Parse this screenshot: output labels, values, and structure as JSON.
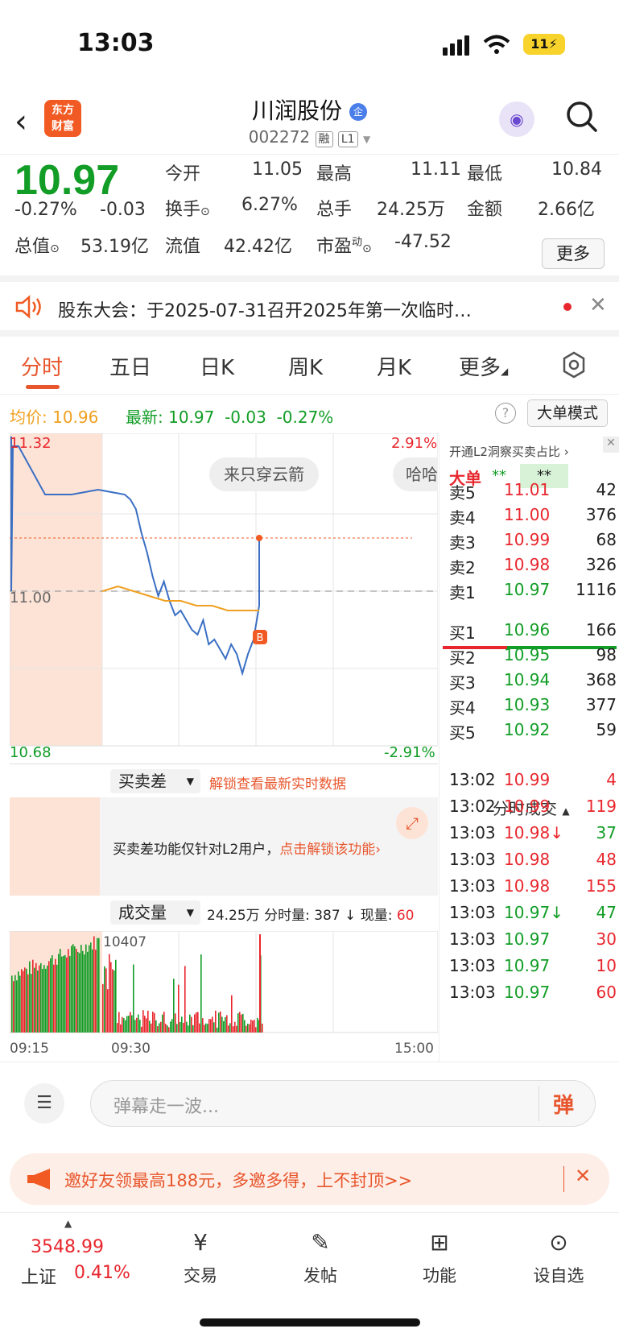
{
  "status": {
    "time": "13:03",
    "battery": "11"
  },
  "header": {
    "logo_line1": "东方",
    "logo_line2": "财富",
    "name": "川润股份",
    "badge": "企",
    "code": "002272",
    "tag1": "融",
    "tag2": "L1"
  },
  "quote": {
    "price": "10.97",
    "change_pct": "-0.27%",
    "change": "-0.03",
    "open_label": "今开",
    "open": "11.05",
    "high_label": "最高",
    "high": "11.11",
    "low_label": "最低",
    "low": "10.84",
    "turnover_label": "换手",
    "turnover": "6.27%",
    "volume_label": "总手",
    "volume": "24.25万",
    "amount_label": "金额",
    "amount": "2.66亿",
    "mktcap_label": "总值",
    "mktcap": "53.19亿",
    "float_label": "流值",
    "float": "42.42亿",
    "pe_label": "市盈",
    "pe_sup": "动",
    "pe": "-47.52",
    "more": "更多"
  },
  "notice": {
    "text": "股东大会：于2025-07-31召开2025年第一次临时…"
  },
  "tabs": [
    "分时",
    "五日",
    "日K",
    "周K",
    "月K",
    "更多"
  ],
  "avg": {
    "avg_label": "均价:",
    "avg": "10.96",
    "latest_label": "最新:",
    "latest": "10.97",
    "chg": "-0.03",
    "pct": "-0.27%",
    "mode": "大单模式"
  },
  "chart_data": {
    "type": "line",
    "title": "",
    "y_range": [
      10.68,
      11.32
    ],
    "y_ticks": {
      "top": "11.32",
      "mid": "11.00",
      "bottom": "10.68",
      "pct_top": "2.91%",
      "pct_bottom": "-2.91%"
    },
    "prev_close": 11.0,
    "x_ticks": [
      "09:15",
      "09:30",
      "15:00"
    ],
    "series": [
      {
        "values": [
          11.3,
          11.2,
          11.2,
          11.21,
          11.2,
          11.19,
          11.17,
          11.12,
          11.08,
          11.03,
          10.99,
          11.02,
          10.98,
          10.95,
          10.96,
          10.94,
          10.92,
          10.91,
          10.94,
          10.89,
          10.9,
          10.88,
          10.86,
          10.89,
          10.87,
          10.83,
          10.87,
          10.9,
          10.97
        ]
      },
      {
        "values": [
          11.0,
          11.01,
          11.0,
          10.99,
          10.98,
          10.98,
          10.97,
          10.97,
          10.96,
          10.96,
          10.96
        ]
      }
    ],
    "markers": {
      "buy": "B",
      "bubble1": "来只穿云箭",
      "bubble2": "哈哈"
    },
    "indicator_label": "买卖差",
    "indicator_unlock": "解锁查看最新实时数据",
    "indicator_msg": "买卖差功能仅针对L2用户，",
    "indicator_link": "点击解锁该功能",
    "volume_label": "成交量",
    "volume_info": "24.25万 分时量: 387 ↓ 现量:",
    "volume_now": "60",
    "volume_max": "10407"
  },
  "orderbook": {
    "promo": "开通L2洞察买卖占比",
    "big_label": "大单",
    "big_stars": "**",
    "big_stars2": "**",
    "asks": [
      [
        "卖5",
        "11.01",
        "42"
      ],
      [
        "卖4",
        "11.00",
        "376"
      ],
      [
        "卖3",
        "10.99",
        "68"
      ],
      [
        "卖2",
        "10.98",
        "326"
      ],
      [
        "卖1",
        "10.97",
        "1116"
      ]
    ],
    "bids": [
      [
        "买1",
        "10.96",
        "166"
      ],
      [
        "买2",
        "10.95",
        "98"
      ],
      [
        "买3",
        "10.94",
        "368"
      ],
      [
        "买4",
        "10.93",
        "377"
      ],
      [
        "买5",
        "10.92",
        "59"
      ]
    ],
    "trades_title": "分时成交",
    "trades": [
      [
        "13:02",
        "10.99",
        "4"
      ],
      [
        "13:02",
        "10.99",
        "119"
      ],
      [
        "13:03",
        "10.98↓",
        "37"
      ],
      [
        "13:03",
        "10.98",
        "48"
      ],
      [
        "13:03",
        "10.98",
        "155"
      ],
      [
        "13:03",
        "10.97↓",
        "47"
      ],
      [
        "13:03",
        "10.97",
        "30"
      ],
      [
        "13:03",
        "10.97",
        "10"
      ],
      [
        "13:03",
        "10.97",
        "60"
      ]
    ]
  },
  "comment": {
    "placeholder": "弹幕走一波...",
    "send": "弹"
  },
  "promo": {
    "text": "邀好友领最高188元，多邀多得，上不封顶>>"
  },
  "nav": {
    "index_value": "3548.99",
    "index_name": "上证",
    "index_pct": "0.41%",
    "trade": "交易",
    "post": "发帖",
    "func": "功能",
    "watch": "设自选"
  }
}
